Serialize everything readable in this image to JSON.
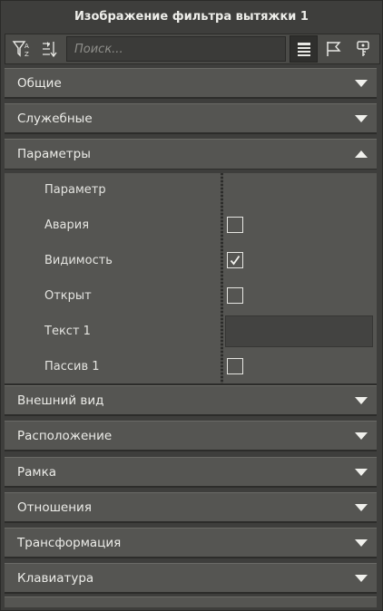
{
  "window": {
    "title": "Изображение фильтра вытяжки 1"
  },
  "toolbar": {
    "search_placeholder": "Поиск...",
    "buttons_left": [
      "filter-icon",
      "sort-icon"
    ],
    "buttons_right": [
      "list-view-icon",
      "flag-icon",
      "key-icon"
    ]
  },
  "sections": [
    {
      "label": "Общие",
      "expanded": false
    },
    {
      "label": "Служебные",
      "expanded": false
    },
    {
      "label": "Параметры",
      "expanded": true
    },
    {
      "label": "Внешний вид",
      "expanded": false
    },
    {
      "label": "Расположение",
      "expanded": false
    },
    {
      "label": "Рамка",
      "expanded": false
    },
    {
      "label": "Отношения",
      "expanded": false
    },
    {
      "label": "Трансформация",
      "expanded": false
    },
    {
      "label": "Клавиатура",
      "expanded": false
    }
  ],
  "parameters": {
    "header_label": "Параметр",
    "rows": [
      {
        "label": "Авария",
        "type": "checkbox",
        "checked": false
      },
      {
        "label": "Видимость",
        "type": "checkbox",
        "checked": true
      },
      {
        "label": "Открыт",
        "type": "checkbox",
        "checked": false
      },
      {
        "label": "Текст 1",
        "type": "text",
        "value": ""
      },
      {
        "label": "Пассив 1",
        "type": "checkbox",
        "checked": false
      }
    ]
  },
  "colors": {
    "panel_bg": "#3e3e3c",
    "section_bg": "#555552",
    "text": "#ecece8"
  }
}
